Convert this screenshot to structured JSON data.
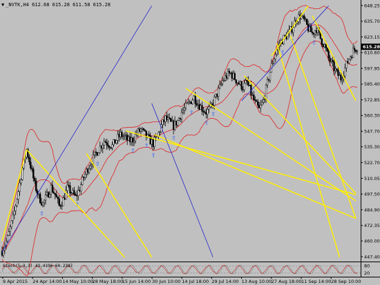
{
  "header": {
    "symbol_line": "_NVTK,H4  612.68 615.28 611.58 615.28"
  },
  "colors": {
    "background": "#c0c0c0",
    "candles": "#000000",
    "bands": "#e02020",
    "trend_yellow": "#ffee00",
    "trend_blue": "#2222cc",
    "fractal_arrows": "#1a57ff",
    "price_badge": "#000000"
  },
  "price_axis": {
    "labels": [
      "648.25",
      "635.70",
      "623.15",
      "610.60",
      "597.95",
      "585.40",
      "572.85",
      "560.30",
      "547.70",
      "535.30",
      "522.70",
      "510.05",
      "497.50",
      "484.90",
      "472.35",
      "460.00",
      "447.40"
    ],
    "current_price": "615.28"
  },
  "time_axis": {
    "labels": [
      "9 Apr 2015",
      "24 Apr 14:00",
      "14 May 10:00",
      "28 May 18:00",
      "15 Jun 14:00",
      "30 Jun 10:00",
      "14 Jul 18:00",
      "29 Jul 14:00",
      "13 Aug 10:00",
      "27 Aug 18:00",
      "11 Sep 14:00",
      "28 Sep 10:00"
    ]
  },
  "oscillator": {
    "label": "Stoch(5,3,3) 42.4196 60.2387",
    "levels": [
      "80",
      "20"
    ]
  },
  "chart_data": {
    "type": "candlestick",
    "ylim": [
      447.4,
      648.25
    ],
    "close_path": [
      [
        0,
        452
      ],
      [
        4,
        462
      ],
      [
        8,
        478
      ],
      [
        12,
        500
      ],
      [
        15,
        518
      ],
      [
        18,
        533
      ],
      [
        21,
        520
      ],
      [
        24,
        505
      ],
      [
        27,
        495
      ],
      [
        30,
        490
      ],
      [
        33,
        496
      ],
      [
        36,
        503
      ],
      [
        39,
        497
      ],
      [
        42,
        488
      ],
      [
        45,
        493
      ],
      [
        48,
        502
      ],
      [
        51,
        499
      ],
      [
        54,
        495
      ],
      [
        57,
        502
      ],
      [
        60,
        511
      ],
      [
        63,
        518
      ],
      [
        66,
        524
      ],
      [
        69,
        530
      ],
      [
        72,
        535
      ],
      [
        75,
        540
      ],
      [
        78,
        538
      ],
      [
        81,
        536
      ],
      [
        84,
        541
      ],
      [
        87,
        545
      ],
      [
        90,
        543
      ],
      [
        93,
        540
      ],
      [
        96,
        541
      ],
      [
        99,
        546
      ],
      [
        102,
        549
      ],
      [
        105,
        545
      ],
      [
        108,
        541
      ],
      [
        111,
        538
      ],
      [
        114,
        543
      ],
      [
        117,
        552
      ],
      [
        120,
        558
      ],
      [
        123,
        555
      ],
      [
        126,
        552
      ],
      [
        129,
        556
      ],
      [
        132,
        563
      ],
      [
        135,
        567
      ],
      [
        138,
        571
      ],
      [
        141,
        575
      ],
      [
        144,
        570
      ],
      [
        147,
        566
      ],
      [
        150,
        563
      ],
      [
        153,
        566
      ],
      [
        156,
        573
      ],
      [
        159,
        580
      ],
      [
        162,
        588
      ],
      [
        165,
        592
      ],
      [
        168,
        594
      ],
      [
        171,
        590
      ],
      [
        174,
        586
      ],
      [
        177,
        583
      ],
      [
        180,
        587
      ],
      [
        183,
        578
      ],
      [
        186,
        570
      ],
      [
        189,
        565
      ],
      [
        192,
        572
      ],
      [
        195,
        586
      ],
      [
        198,
        600
      ],
      [
        201,
        610
      ],
      [
        204,
        618
      ],
      [
        207,
        622
      ],
      [
        210,
        625
      ],
      [
        213,
        630
      ],
      [
        216,
        637
      ],
      [
        219,
        640
      ],
      [
        222,
        636
      ],
      [
        225,
        630
      ],
      [
        228,
        626
      ],
      [
        231,
        630
      ],
      [
        234,
        622
      ],
      [
        237,
        616
      ],
      [
        240,
        606
      ],
      [
        243,
        600
      ],
      [
        246,
        594
      ],
      [
        249,
        590
      ],
      [
        252,
        598
      ],
      [
        255,
        606
      ],
      [
        258,
        612
      ],
      [
        261,
        615
      ]
    ]
  }
}
